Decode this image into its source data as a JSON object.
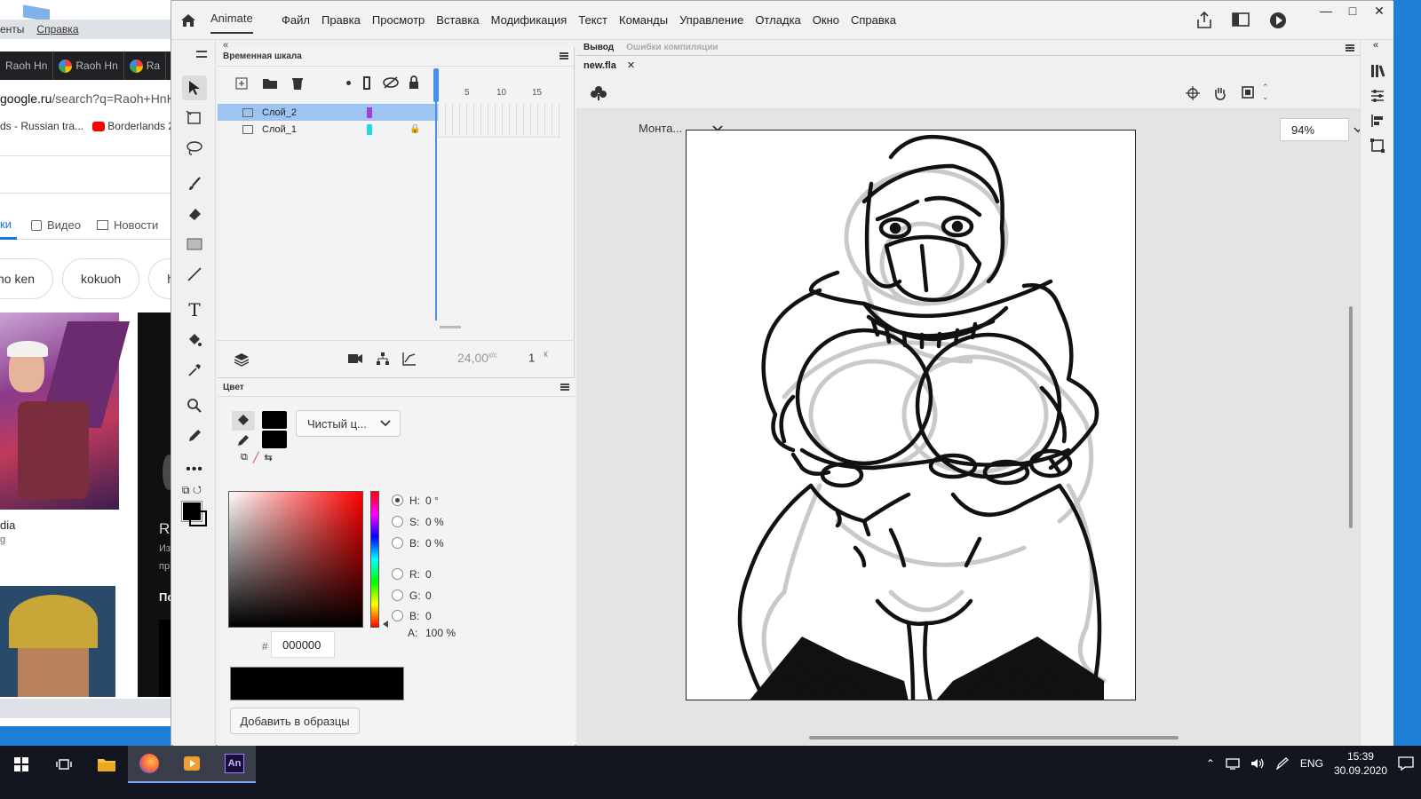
{
  "browser": {
    "menu": [
      "енты",
      "Справка"
    ],
    "tabs": [
      "Raoh Hn",
      "Raoh Hn",
      "Ra"
    ],
    "url_host": "google.ru",
    "url_path": "/search?q=Raoh+HnK&",
    "bookmarks": [
      "ds - Russian tra...",
      "Borderlands 2"
    ],
    "search_tabs": [
      "ки",
      "Видео",
      "Новости"
    ],
    "chips": [
      "no ken",
      "kokuoh",
      "ho"
    ],
    "result_caption": "dia",
    "result_sub": "g",
    "dark_panel_texts": [
      "R",
      "Из",
      "пр",
      "По"
    ]
  },
  "app": {
    "workspace": "Animate",
    "menus": [
      "Файл",
      "Правка",
      "Просмотр",
      "Вставка",
      "Модификация",
      "Текст",
      "Команды",
      "Управление",
      "Отладка",
      "Окно",
      "Справка"
    ]
  },
  "timeline": {
    "title": "Временная шкала",
    "ruler": [
      "5",
      "10",
      "15"
    ],
    "layers": [
      {
        "name": "Слой_2",
        "color": "#a040d0",
        "selected": true,
        "locked": false
      },
      {
        "name": "Слой_1",
        "color": "#20d8e8",
        "selected": false,
        "locked": true
      }
    ],
    "fps": "24,00",
    "fps_unit": "к/с",
    "frame": "1",
    "frame_unit": "К"
  },
  "color_panel": {
    "title": "Цвет",
    "fill_type": "Чистый ц...",
    "hsb": [
      {
        "label": "H:",
        "value": "0 °",
        "selected": true
      },
      {
        "label": "S:",
        "value": "0 %",
        "selected": false
      },
      {
        "label": "B:",
        "value": "0 %",
        "selected": false
      }
    ],
    "rgb": [
      {
        "label": "R:",
        "value": "0"
      },
      {
        "label": "G:",
        "value": "0"
      },
      {
        "label": "B:",
        "value": "0"
      }
    ],
    "alpha_label": "A:",
    "alpha_value": "100 %",
    "hex_prefix": "#",
    "hex": "000000",
    "add_swatch": "Добавить в образцы"
  },
  "stage": {
    "output_tab": "Вывод",
    "errors_tab": "Ошибки компиляции",
    "file_tab": "new.fla",
    "scene": "Монта...",
    "zoom": "94%"
  },
  "taskbar": {
    "lang": "ENG",
    "time": "15:39",
    "date": "30.09.2020",
    "app_label": "An"
  }
}
